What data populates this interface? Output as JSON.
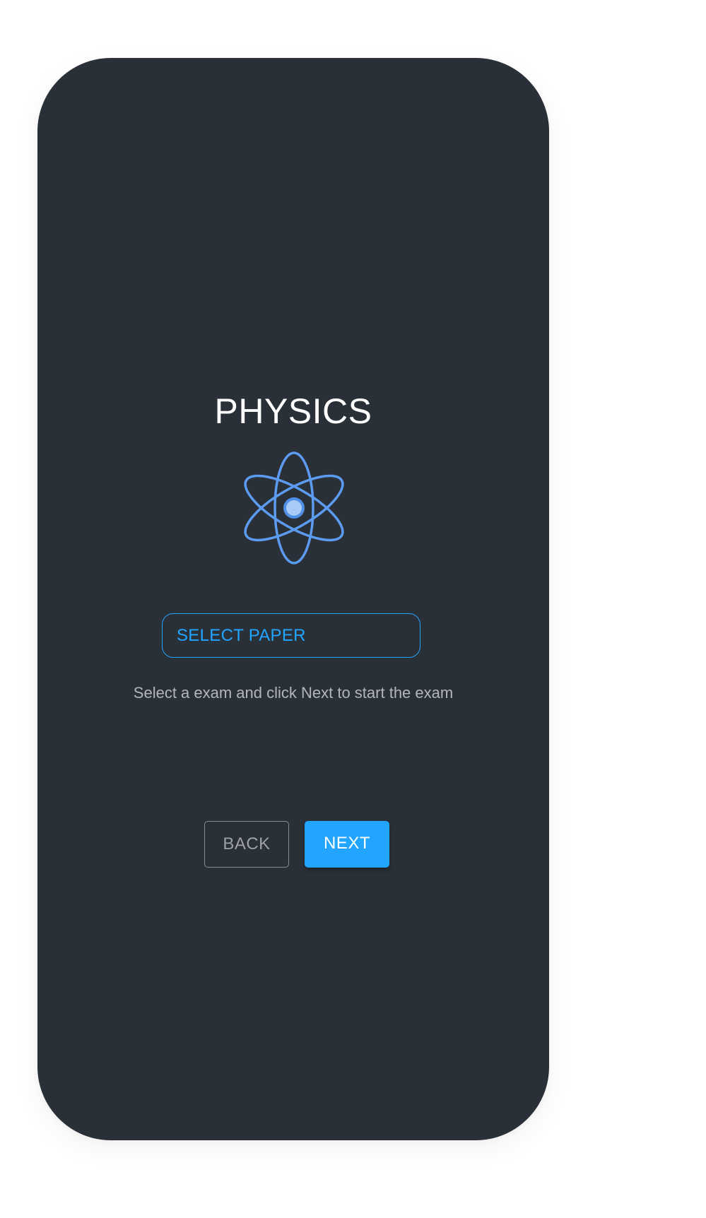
{
  "screen": {
    "title": "PHYSICS",
    "icon": "atom-icon",
    "select": {
      "label": "SELECT PAPER"
    },
    "hint": "Select a exam and click Next to start the exam",
    "buttons": {
      "back_label": "BACK",
      "next_label": "NEXT"
    }
  },
  "colors": {
    "background": "#ffffff",
    "card": "#2a3037",
    "accent": "#21a5ff",
    "atom": "#5b9bf0",
    "hint_text": "#b3b6ba"
  }
}
